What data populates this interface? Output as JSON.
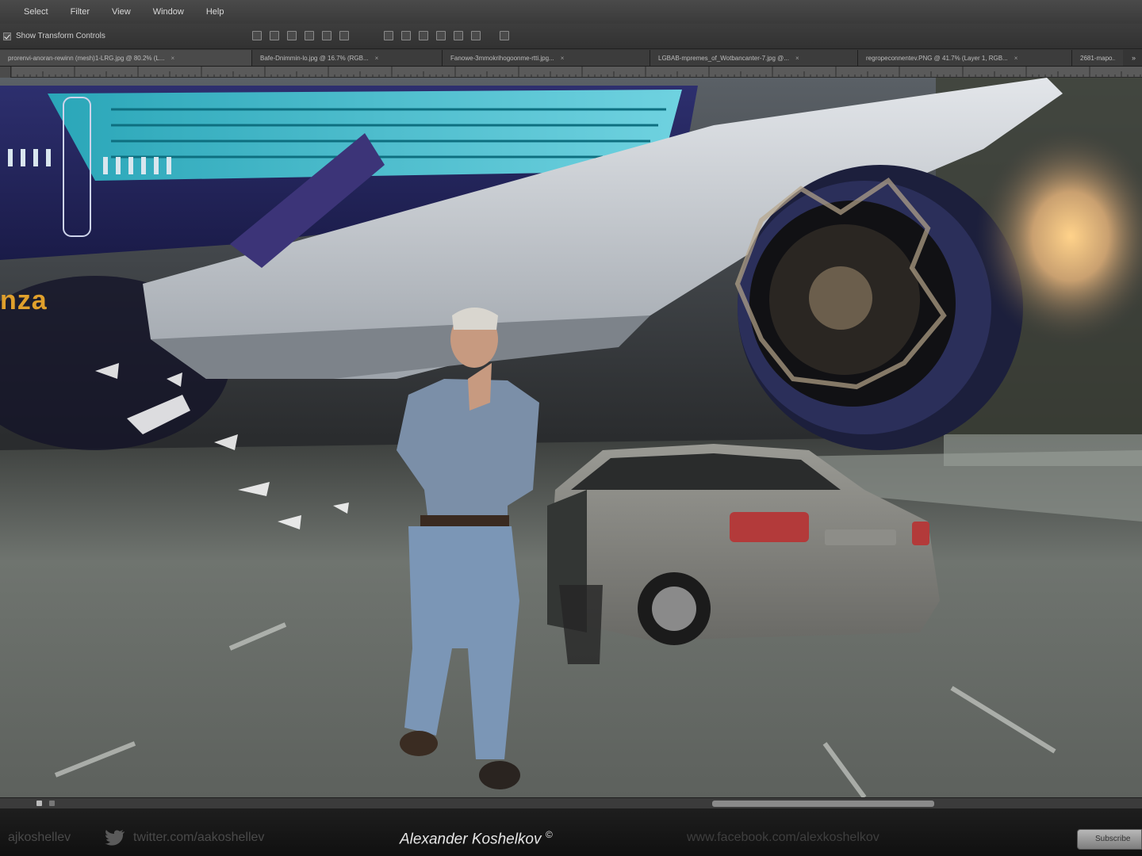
{
  "menu": {
    "items": [
      "Select",
      "Filter",
      "View",
      "Window",
      "Help"
    ]
  },
  "options": {
    "show_transform_label": "Show Transform Controls"
  },
  "tabs": [
    {
      "label": "prorenvi-anoran-rewinn (mesh)1-LRG.jpg @ 80.2% (L..."
    },
    {
      "label": "Bafe-Dnimmin-lo.jpg @ 16.7% (RGB..."
    },
    {
      "label": "Fanowe-3mmokrihogoonme-rtti.jpg..."
    },
    {
      "label": "LGBAB-mpremes_of_Wotbancanter-7.jpg @..."
    },
    {
      "label": "regropeconnentev.PNG @ 41.7% (Layer 1, RGB..."
    },
    {
      "label": "2681-mapo..."
    }
  ],
  "artwork": {
    "livery_text": "nza"
  },
  "footer": {
    "handle": "ajkoshellev",
    "twitter": "twitter.com/aakoshellev",
    "author": "Alexander Koshelkov",
    "author_mark": "©",
    "site": "www.facebook.com/alexkoshelkov",
    "button_label": "Subscribe"
  },
  "colors": {
    "menubar": "#3f3f3f",
    "canvas_sky": "#3a3d42",
    "road": "#6e726e",
    "livery_accent": "#e0a02c"
  }
}
